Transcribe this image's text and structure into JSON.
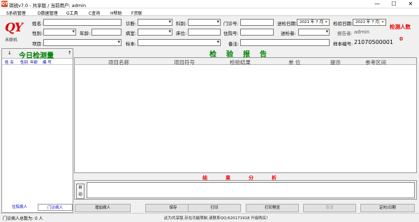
{
  "window": {
    "title": "琪锐v7.0 - 共享版  /  当前用户: admin",
    "icon_text": "QY",
    "controls": [
      "—",
      "☐",
      "✕"
    ]
  },
  "menu": [
    "S系统管理",
    "D数据管理",
    "G工具",
    "C查询",
    "H帮助",
    "F资联"
  ],
  "logo": {
    "mark": "QY",
    "sub": "未联机"
  },
  "form": {
    "name_label": "姓名:",
    "diagnosis_label": "诊断:",
    "dept_label": "科别:",
    "outpatient_label": "门诊号:",
    "send_date_label": "送检日期:",
    "send_date_value": "2021 年  7 月",
    "test_date_label": "检验日期:",
    "test_date_value": "2021 年  7 月",
    "gender_label": "性别:",
    "age_label": "年龄:",
    "ward_label": "病室:",
    "bed_label": "床位:",
    "inpatient_label": "住院号:",
    "sender_label": "送检者:",
    "reporter_label": "报告者:",
    "reporter_value": "admin",
    "item_label": "项目:",
    "specimen_label": "标本:",
    "remark_label": "备注:",
    "sample_no_label": "样本编号:",
    "sample_no_value": "21070500001"
  },
  "count": {
    "title": "检测人数",
    "value": "0"
  },
  "left_panel": {
    "title": "今日检测量",
    "arrow_left": "↓",
    "arrow_right": "↑",
    "columns": [
      "姓 名",
      "性别",
      "年龄",
      "编 号"
    ]
  },
  "report": {
    "title": "检验报告",
    "columns": [
      "项目名称",
      "项目符号",
      "检验结果",
      "单 位",
      "提示",
      "参考区间"
    ]
  },
  "analysis": {
    "title": "结果分析",
    "auto_label": "自动"
  },
  "tabs": [
    "住院病人",
    "门诊病人"
  ],
  "buttons": [
    "增加病人",
    "保存",
    "打印",
    "打印预览",
    "取消",
    "定时/日期"
  ],
  "status": {
    "left": "门诊病人总数为:  0 人",
    "center": "此为共享版,存在功能限制,请联系QQ:620171918 升级购买!"
  }
}
